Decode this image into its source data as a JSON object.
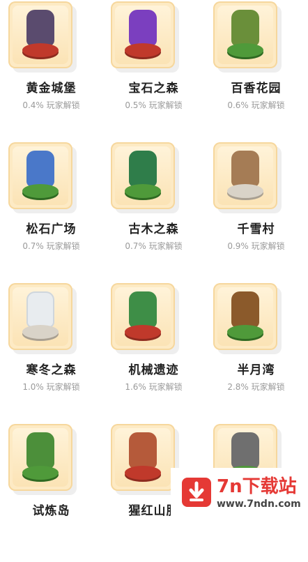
{
  "items": [
    {
      "name": "黄金城堡",
      "unlock": "0.4% 玩家解锁",
      "icon": "golden-castle-icon",
      "color": "#5a4b6e",
      "base": "red"
    },
    {
      "name": "宝石之森",
      "unlock": "0.5% 玩家解锁",
      "icon": "gem-forest-icon",
      "color": "#7b3fbf",
      "base": "red"
    },
    {
      "name": "百香花园",
      "unlock": "0.6% 玩家解锁",
      "icon": "flower-garden-icon",
      "color": "#6a8f3a",
      "base": "green"
    },
    {
      "name": "松石广场",
      "unlock": "0.7% 玩家解锁",
      "icon": "turquoise-square-icon",
      "color": "#4a78c9",
      "base": "green"
    },
    {
      "name": "古木之森",
      "unlock": "0.7% 玩家解锁",
      "icon": "ancient-forest-icon",
      "color": "#2f7d4a",
      "base": "green"
    },
    {
      "name": "千雪村",
      "unlock": "0.9% 玩家解锁",
      "icon": "snow-village-icon",
      "color": "#a57c55",
      "base": "stone"
    },
    {
      "name": "寒冬之森",
      "unlock": "1.0% 玩家解锁",
      "icon": "winter-forest-icon",
      "color": "#e8ecef",
      "base": "stone"
    },
    {
      "name": "机械遗迹",
      "unlock": "1.6% 玩家解锁",
      "icon": "mechanical-ruins-icon",
      "color": "#3e8e47",
      "base": "red"
    },
    {
      "name": "半月湾",
      "unlock": "2.8% 玩家解锁",
      "icon": "half-moon-bay-icon",
      "color": "#8b5a2b",
      "base": "green"
    },
    {
      "name": "试炼岛",
      "unlock": "",
      "icon": "trial-island-icon",
      "color": "#4c8f3a",
      "base": "green"
    },
    {
      "name": "猩红山肌",
      "unlock": "",
      "icon": "scarlet-mountain-icon",
      "color": "#b55a3a",
      "base": "red"
    },
    {
      "name": "",
      "unlock": "",
      "icon": "stone-monolith-icon",
      "color": "#6f6f6f",
      "base": "green"
    }
  ],
  "watermark": {
    "title": "7n下载站",
    "url": "www.7ndn.com"
  }
}
